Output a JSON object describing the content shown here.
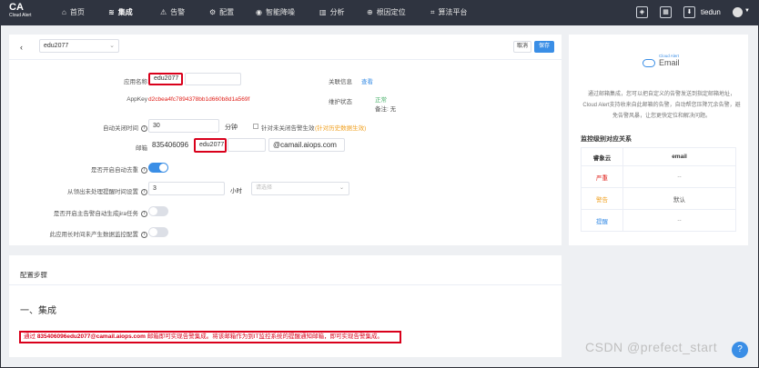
{
  "brand": {
    "title": "CA",
    "subtitle": "Cloud Alert"
  },
  "nav": {
    "items": [
      {
        "label": "首页",
        "icon": "home-icon",
        "glyph": "⌂"
      },
      {
        "label": "集成",
        "icon": "layers-icon",
        "glyph": "≋"
      },
      {
        "label": "告警",
        "icon": "alert-icon",
        "glyph": "⚠"
      },
      {
        "label": "配置",
        "icon": "gear-icon",
        "glyph": "⚙"
      },
      {
        "label": "智能降噪",
        "icon": "noise-icon",
        "glyph": "◉"
      },
      {
        "label": "分析",
        "icon": "chart-icon",
        "glyph": "▥"
      },
      {
        "label": "根因定位",
        "icon": "target-icon",
        "glyph": "⊕"
      },
      {
        "label": "算法平台",
        "icon": "algorithm-icon",
        "glyph": "⌗"
      }
    ],
    "user": "tiedun"
  },
  "header": {
    "app_value": "edu2077",
    "cancel": "取消",
    "save": "保存"
  },
  "form": {
    "app_name_label": "应用名称",
    "app_name_value": "edu2077",
    "appkey_label": "AppKey",
    "appkey_value": "d2cbea4fc7894378bb1d660b8d1a569f",
    "related_label": "关联信息",
    "related_link": "查看",
    "maint_label": "维护状态",
    "maint_value": "正常",
    "maint_note": "备注: 无",
    "auto_close_label": "自动关闭时间",
    "auto_close_value": "30",
    "auto_close_unit": "分钟",
    "auto_close_check": "针对未关闭告警生效",
    "auto_close_hint": "(针对历史数据生效)",
    "mail_label": "邮箱",
    "mail_prefix": "835406096",
    "mail_name": "edu2077",
    "mail_domain": "@camail.aiops.com",
    "dedupe_label": "是否开启自动去重",
    "reminder_label": "从领出未处理提醒时间设置",
    "reminder_value": "3",
    "reminder_unit": "小时",
    "reminder_select": "请选择",
    "jira_label": "是否开启主告警自动生成jira任务",
    "nodata_label": "此应用长时间未产生数据监控配置"
  },
  "steps": {
    "title": "配置步骤",
    "h2": "一、集成",
    "note_prefix": "通过",
    "note_email": "835406096edu2077@camail.aiops.com",
    "note_suffix": "邮箱即可实现告警集成。将该邮箱作为到IT监控系统的提醒通知邮箱，即可实现告警集成。"
  },
  "side": {
    "logo_small": "Cloud Alert",
    "logo_word": "Email",
    "desc": "通过邮箱集成，您可以把自定义的告警发送到指定邮箱地址，Cloud Alert支持收来自此邮箱的告警，自动帮您压降冗余告警，避免告警风暴，让您更快定位和解决问题。",
    "mapping_title": "监控级别对应关系",
    "table_head": [
      "睿象云",
      "email"
    ],
    "rows": [
      {
        "level": "严重",
        "value": "--",
        "color": "#e0211b"
      },
      {
        "level": "警告",
        "value": "默认",
        "color": "#f0a020"
      },
      {
        "level": "提醒",
        "value": "--",
        "color": "#3a8ee6"
      }
    ]
  },
  "watermark": "CSDN @prefect_start",
  "colors": {
    "nav_bg": "#2f3440",
    "accent": "#3a8ee6",
    "highlight": "#d9001b"
  }
}
